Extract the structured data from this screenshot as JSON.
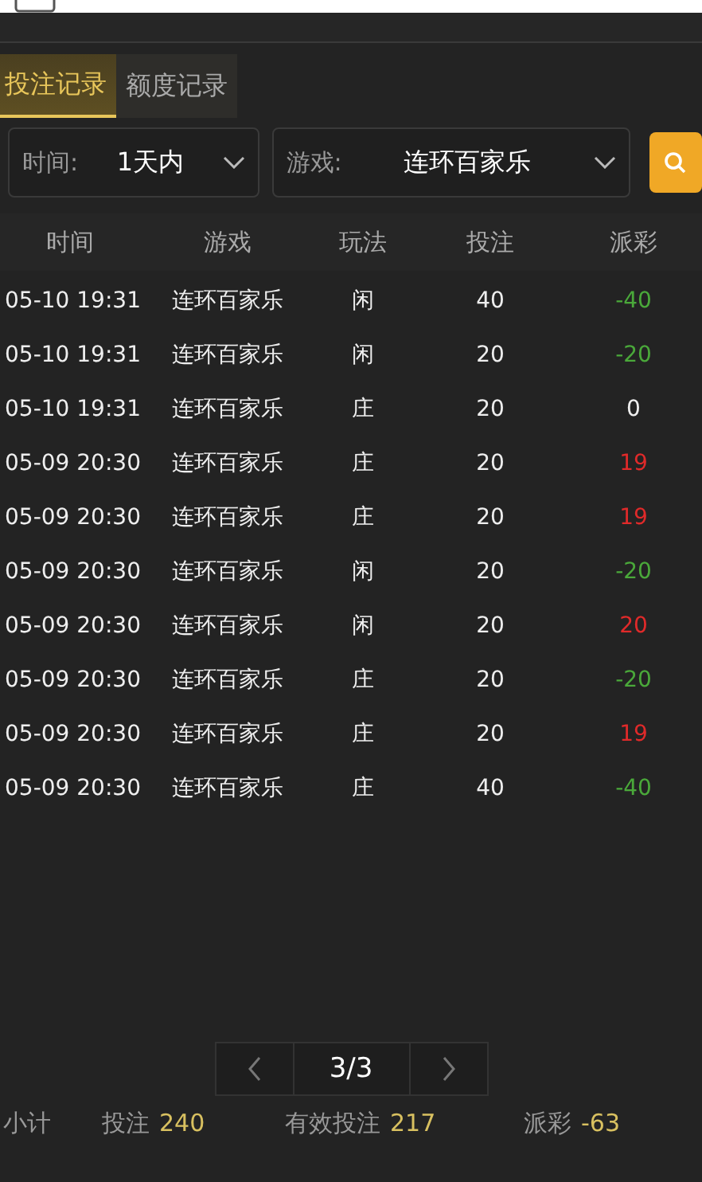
{
  "tabs": [
    {
      "label": "投注记录",
      "selected": true
    },
    {
      "label": "额度记录",
      "selected": false
    }
  ],
  "filters": [
    {
      "label": "时间:",
      "value": "1天内"
    },
    {
      "label": "游戏:",
      "value": "连环百家乐"
    }
  ],
  "table": {
    "columns": [
      "时间",
      "游戏",
      "玩法",
      "投注",
      "派彩"
    ],
    "rows": [
      {
        "cells": [
          "05-10 19:31",
          "连环百家乐",
          "闲",
          "40",
          "-40"
        ],
        "color": "#4aa83a"
      },
      {
        "cells": [
          "05-10 19:31",
          "连环百家乐",
          "闲",
          "20",
          "-20"
        ],
        "color": "#4aa83a"
      },
      {
        "cells": [
          "05-10 19:31",
          "连环百家乐",
          "庄",
          "20",
          "0"
        ],
        "color": "#eeeeee"
      },
      {
        "cells": [
          "05-09 20:30",
          "连环百家乐",
          "庄",
          "20",
          "19"
        ],
        "color": "#e02a2a"
      },
      {
        "cells": [
          "05-09 20:30",
          "连环百家乐",
          "庄",
          "20",
          "19"
        ],
        "color": "#e02a2a"
      },
      {
        "cells": [
          "05-09 20:30",
          "连环百家乐",
          "闲",
          "20",
          "-20"
        ],
        "color": "#4aa83a"
      },
      {
        "cells": [
          "05-09 20:30",
          "连环百家乐",
          "闲",
          "20",
          "20"
        ],
        "color": "#e02a2a"
      },
      {
        "cells": [
          "05-09 20:30",
          "连环百家乐",
          "庄",
          "20",
          "-20"
        ],
        "color": "#4aa83a"
      },
      {
        "cells": [
          "05-09 20:30",
          "连环百家乐",
          "庄",
          "20",
          "19"
        ],
        "color": "#e02a2a"
      },
      {
        "cells": [
          "05-09 20:30",
          "连环百家乐",
          "庄",
          "40",
          "-40"
        ],
        "color": "#4aa83a"
      }
    ]
  },
  "pagination": {
    "page": "3/3"
  },
  "summary": {
    "label": "小计",
    "items": [
      {
        "label": "投注",
        "value": "240"
      },
      {
        "label": "有效投注",
        "value": "217"
      },
      {
        "label": "派彩",
        "value": "-63"
      }
    ]
  }
}
